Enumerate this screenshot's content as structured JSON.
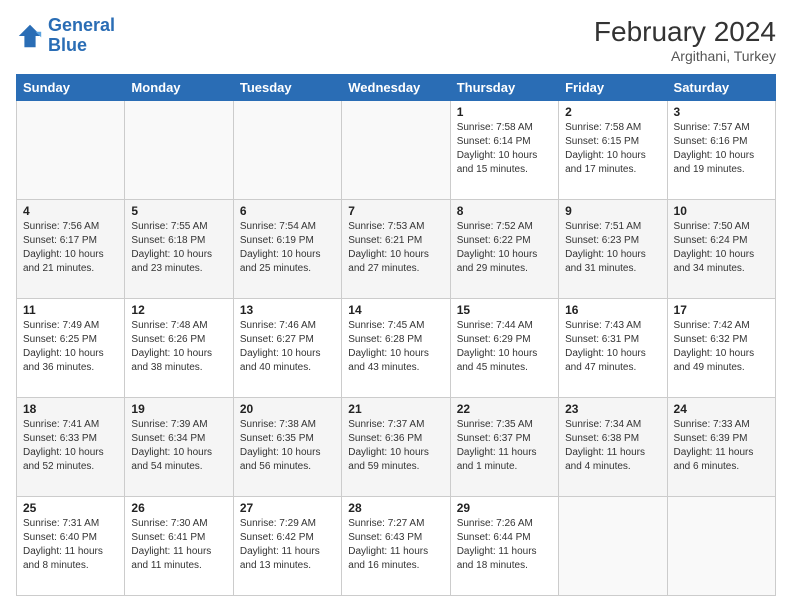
{
  "header": {
    "logo_line1": "General",
    "logo_line2": "Blue",
    "title": "February 2024",
    "subtitle": "Argithani, Turkey"
  },
  "weekdays": [
    "Sunday",
    "Monday",
    "Tuesday",
    "Wednesday",
    "Thursday",
    "Friday",
    "Saturday"
  ],
  "weeks": [
    [
      {
        "day": "",
        "info": ""
      },
      {
        "day": "",
        "info": ""
      },
      {
        "day": "",
        "info": ""
      },
      {
        "day": "",
        "info": ""
      },
      {
        "day": "1",
        "info": "Sunrise: 7:58 AM\nSunset: 6:14 PM\nDaylight: 10 hours\nand 15 minutes."
      },
      {
        "day": "2",
        "info": "Sunrise: 7:58 AM\nSunset: 6:15 PM\nDaylight: 10 hours\nand 17 minutes."
      },
      {
        "day": "3",
        "info": "Sunrise: 7:57 AM\nSunset: 6:16 PM\nDaylight: 10 hours\nand 19 minutes."
      }
    ],
    [
      {
        "day": "4",
        "info": "Sunrise: 7:56 AM\nSunset: 6:17 PM\nDaylight: 10 hours\nand 21 minutes."
      },
      {
        "day": "5",
        "info": "Sunrise: 7:55 AM\nSunset: 6:18 PM\nDaylight: 10 hours\nand 23 minutes."
      },
      {
        "day": "6",
        "info": "Sunrise: 7:54 AM\nSunset: 6:19 PM\nDaylight: 10 hours\nand 25 minutes."
      },
      {
        "day": "7",
        "info": "Sunrise: 7:53 AM\nSunset: 6:21 PM\nDaylight: 10 hours\nand 27 minutes."
      },
      {
        "day": "8",
        "info": "Sunrise: 7:52 AM\nSunset: 6:22 PM\nDaylight: 10 hours\nand 29 minutes."
      },
      {
        "day": "9",
        "info": "Sunrise: 7:51 AM\nSunset: 6:23 PM\nDaylight: 10 hours\nand 31 minutes."
      },
      {
        "day": "10",
        "info": "Sunrise: 7:50 AM\nSunset: 6:24 PM\nDaylight: 10 hours\nand 34 minutes."
      }
    ],
    [
      {
        "day": "11",
        "info": "Sunrise: 7:49 AM\nSunset: 6:25 PM\nDaylight: 10 hours\nand 36 minutes."
      },
      {
        "day": "12",
        "info": "Sunrise: 7:48 AM\nSunset: 6:26 PM\nDaylight: 10 hours\nand 38 minutes."
      },
      {
        "day": "13",
        "info": "Sunrise: 7:46 AM\nSunset: 6:27 PM\nDaylight: 10 hours\nand 40 minutes."
      },
      {
        "day": "14",
        "info": "Sunrise: 7:45 AM\nSunset: 6:28 PM\nDaylight: 10 hours\nand 43 minutes."
      },
      {
        "day": "15",
        "info": "Sunrise: 7:44 AM\nSunset: 6:29 PM\nDaylight: 10 hours\nand 45 minutes."
      },
      {
        "day": "16",
        "info": "Sunrise: 7:43 AM\nSunset: 6:31 PM\nDaylight: 10 hours\nand 47 minutes."
      },
      {
        "day": "17",
        "info": "Sunrise: 7:42 AM\nSunset: 6:32 PM\nDaylight: 10 hours\nand 49 minutes."
      }
    ],
    [
      {
        "day": "18",
        "info": "Sunrise: 7:41 AM\nSunset: 6:33 PM\nDaylight: 10 hours\nand 52 minutes."
      },
      {
        "day": "19",
        "info": "Sunrise: 7:39 AM\nSunset: 6:34 PM\nDaylight: 10 hours\nand 54 minutes."
      },
      {
        "day": "20",
        "info": "Sunrise: 7:38 AM\nSunset: 6:35 PM\nDaylight: 10 hours\nand 56 minutes."
      },
      {
        "day": "21",
        "info": "Sunrise: 7:37 AM\nSunset: 6:36 PM\nDaylight: 10 hours\nand 59 minutes."
      },
      {
        "day": "22",
        "info": "Sunrise: 7:35 AM\nSunset: 6:37 PM\nDaylight: 11 hours\nand 1 minute."
      },
      {
        "day": "23",
        "info": "Sunrise: 7:34 AM\nSunset: 6:38 PM\nDaylight: 11 hours\nand 4 minutes."
      },
      {
        "day": "24",
        "info": "Sunrise: 7:33 AM\nSunset: 6:39 PM\nDaylight: 11 hours\nand 6 minutes."
      }
    ],
    [
      {
        "day": "25",
        "info": "Sunrise: 7:31 AM\nSunset: 6:40 PM\nDaylight: 11 hours\nand 8 minutes."
      },
      {
        "day": "26",
        "info": "Sunrise: 7:30 AM\nSunset: 6:41 PM\nDaylight: 11 hours\nand 11 minutes."
      },
      {
        "day": "27",
        "info": "Sunrise: 7:29 AM\nSunset: 6:42 PM\nDaylight: 11 hours\nand 13 minutes."
      },
      {
        "day": "28",
        "info": "Sunrise: 7:27 AM\nSunset: 6:43 PM\nDaylight: 11 hours\nand 16 minutes."
      },
      {
        "day": "29",
        "info": "Sunrise: 7:26 AM\nSunset: 6:44 PM\nDaylight: 11 hours\nand 18 minutes."
      },
      {
        "day": "",
        "info": ""
      },
      {
        "day": "",
        "info": ""
      }
    ]
  ]
}
